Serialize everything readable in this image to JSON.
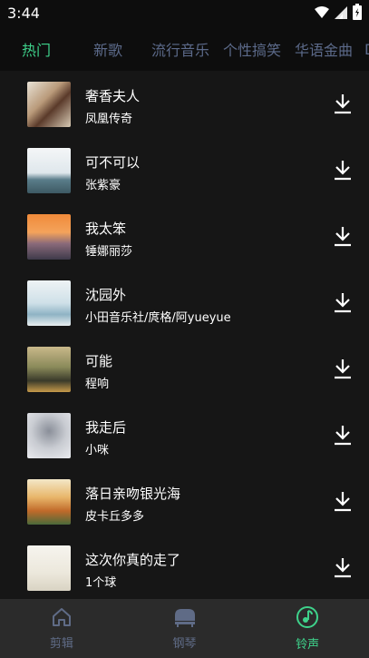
{
  "status_bar": {
    "time": "3:44",
    "icons": [
      "wifi-icon",
      "signal-icon",
      "battery-icon"
    ]
  },
  "tabs": [
    {
      "label": "热门",
      "active": true
    },
    {
      "label": "新歌",
      "active": false
    },
    {
      "label": "流行音乐",
      "active": false
    },
    {
      "label": "个性搞笑",
      "active": false
    },
    {
      "label": "华语金曲",
      "active": false
    },
    {
      "label": "D",
      "active": false
    }
  ],
  "songs": [
    {
      "title": "奢香夫人",
      "artist": "凤凰传奇"
    },
    {
      "title": "可不可以",
      "artist": "张紫豪"
    },
    {
      "title": "我太笨",
      "artist": "锤娜丽莎"
    },
    {
      "title": "沈园外",
      "artist": "小田音乐社/庹格/阿yueyue"
    },
    {
      "title": "可能",
      "artist": "程响"
    },
    {
      "title": "我走后",
      "artist": "小咪"
    },
    {
      "title": "落日亲吻银光海",
      "artist": "皮卡丘多多"
    },
    {
      "title": "这次你真的走了",
      "artist": "1个球"
    }
  ],
  "bottom_nav": [
    {
      "label": "剪辑",
      "icon": "home-icon",
      "active": false
    },
    {
      "label": "钢琴",
      "icon": "piano-icon",
      "active": false
    },
    {
      "label": "铃声",
      "icon": "music-note-icon",
      "active": true
    }
  ],
  "colors": {
    "accent": "#3ed28b",
    "inactive_tab": "#5c6a8a",
    "inactive_nav": "#5f6b86",
    "background": "#161616",
    "nav_background": "#2b2b2b"
  }
}
